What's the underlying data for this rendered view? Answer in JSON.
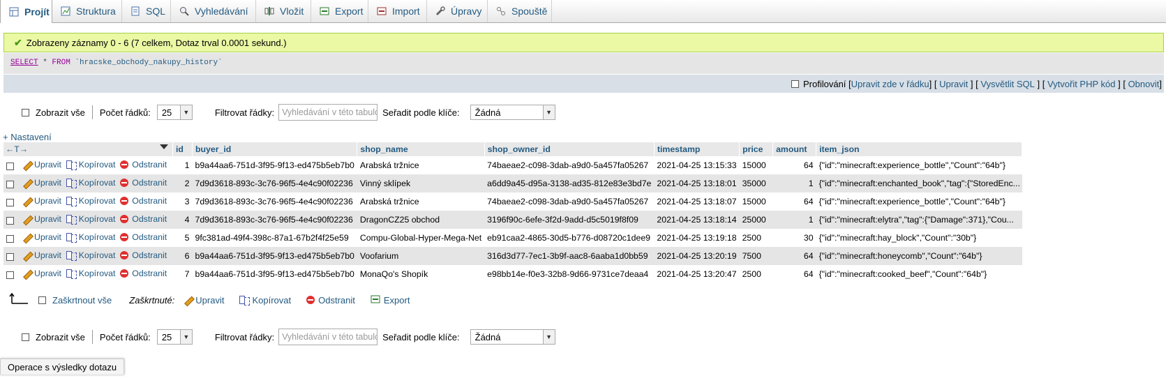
{
  "tabs": [
    {
      "label": "Projít",
      "icon": "browse-icon"
    },
    {
      "label": "Struktura",
      "icon": "structure-icon"
    },
    {
      "label": "SQL",
      "icon": "sql-icon"
    },
    {
      "label": "Vyhledávání",
      "icon": "search-icon"
    },
    {
      "label": "Vložit",
      "icon": "insert-icon"
    },
    {
      "label": "Export",
      "icon": "export-icon"
    },
    {
      "label": "Import",
      "icon": "import-icon"
    },
    {
      "label": "Úpravy",
      "icon": "wrench-icon"
    },
    {
      "label": "Spouště",
      "icon": "triggers-icon"
    }
  ],
  "message": {
    "success": "Zobrazeny záznamy 0 - 6 (7 celkem, Dotaz trval 0.0001 sekund.)",
    "sql_kw1": "SELECT",
    "sql_mid": " * ",
    "sql_kw2": "FROM",
    "sql_table": " `hracske_obchody_nakupy_history`"
  },
  "toolbar": {
    "profiling": "Profilování",
    "edit_inline": "Upravit zde v řádku",
    "edit": "Upravit",
    "explain": "Vysvětlit SQL",
    "php": "Vytvořit PHP kód",
    "refresh": "Obnovit"
  },
  "nav": {
    "show_all": "Zobrazit vše",
    "rows_label": "Počet řádků:",
    "rows_value": "25",
    "filter_label": "Filtrovat řádky:",
    "filter_placeholder": "Vyhledávání v této tabulce",
    "sort_label": "Seřadit podle klíče:",
    "sort_value": "Žádná"
  },
  "settings_link": "+ Nastavení",
  "columns": [
    "id",
    "buyer_id",
    "shop_name",
    "shop_owner_id",
    "timestamp",
    "price",
    "amount",
    "item_json"
  ],
  "actions": {
    "edit": "Upravit",
    "copy": "Kopírovat",
    "delete": "Odstranit"
  },
  "rows": [
    {
      "id": "1",
      "buyer_id": "b9a44aa6-751d-3f95-9f13-ed475b5eb7b0",
      "shop_name": "Arabská tržnice",
      "shop_owner_id": "74baeae2-c098-3dab-a9d0-5a457fa05267",
      "timestamp": "2021-04-25 13:15:33",
      "price": "15000",
      "amount": "64",
      "item_json": "{\"id\":\"minecraft:experience_bottle\",\"Count\":\"64b\"}"
    },
    {
      "id": "2",
      "buyer_id": "7d9d3618-893c-3c76-96f5-4e4c90f02236",
      "shop_name": "Vinný sklípek",
      "shop_owner_id": "a6dd9a45-d95a-3138-ad35-812e83e3bd7e",
      "timestamp": "2021-04-25 13:18:01",
      "price": "35000",
      "amount": "1",
      "item_json": "{\"id\":\"minecraft:enchanted_book\",\"tag\":{\"StoredEnc..."
    },
    {
      "id": "3",
      "buyer_id": "7d9d3618-893c-3c76-96f5-4e4c90f02236",
      "shop_name": "Arabská tržnice",
      "shop_owner_id": "74baeae2-c098-3dab-a9d0-5a457fa05267",
      "timestamp": "2021-04-25 13:18:07",
      "price": "15000",
      "amount": "64",
      "item_json": "{\"id\":\"minecraft:experience_bottle\",\"Count\":\"64b\"}"
    },
    {
      "id": "4",
      "buyer_id": "7d9d3618-893c-3c76-96f5-4e4c90f02236",
      "shop_name": "DragonCZ25 obchod",
      "shop_owner_id": "3196f90c-6efe-3f2d-9add-d5c5019f8f09",
      "timestamp": "2021-04-25 13:18:14",
      "price": "25000",
      "amount": "1",
      "item_json": "{\"id\":\"minecraft:elytra\",\"tag\":{\"Damage\":371},\"Cou..."
    },
    {
      "id": "5",
      "buyer_id": "9fc381ad-49f4-398c-87a1-67b2f4f25e59",
      "shop_name": "Compu-Global-Hyper-Mega-Net",
      "shop_owner_id": "eb91caa2-4865-30d5-b776-d08720c1dee9",
      "timestamp": "2021-04-25 13:19:18",
      "price": "2500",
      "amount": "30",
      "item_json": "{\"id\":\"minecraft:hay_block\",\"Count\":\"30b\"}"
    },
    {
      "id": "6",
      "buyer_id": "b9a44aa6-751d-3f95-9f13-ed475b5eb7b0",
      "shop_name": "Voofarium",
      "shop_owner_id": "316d3d77-7ec1-3b9f-aac8-6aaba1d0bb59",
      "timestamp": "2021-04-25 13:20:19",
      "price": "7500",
      "amount": "64",
      "item_json": "{\"id\":\"minecraft:honeycomb\",\"Count\":\"64b\"}"
    },
    {
      "id": "7",
      "buyer_id": "b9a44aa6-751d-3f95-9f13-ed475b5eb7b0",
      "shop_name": "MonaQo's Shopík",
      "shop_owner_id": "e98bb14e-f0e3-32b8-9d66-9731ce7deaa4",
      "timestamp": "2021-04-25 13:20:47",
      "price": "2500",
      "amount": "64",
      "item_json": "{\"id\":\"minecraft:cooked_beef\",\"Count\":\"64b\"}"
    }
  ],
  "bulk": {
    "check_all": "Zaškrtnout vše",
    "checked": "Zaškrtnuté:",
    "edit": "Upravit",
    "copy": "Kopírovat",
    "delete": "Odstranit",
    "export": "Export"
  },
  "ops_title": "Operace s výsledky dotazu"
}
